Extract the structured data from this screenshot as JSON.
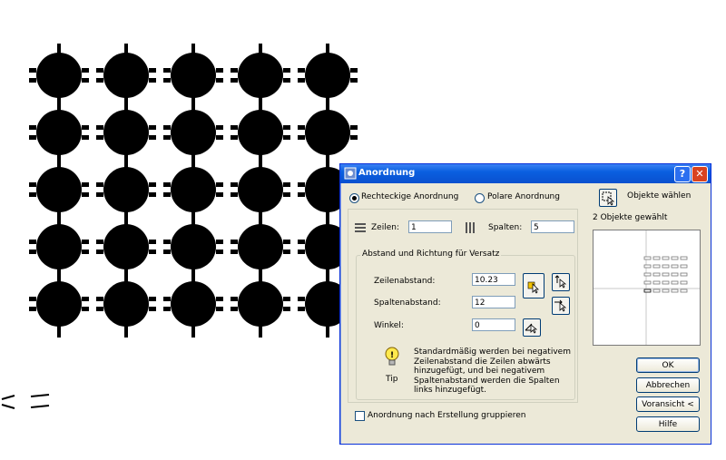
{
  "dialog": {
    "title": "Anordnung",
    "help_label": "?",
    "close_label": "✕",
    "radio_rect_label": "Rechteckige Anordnung",
    "radio_polar_label": "Polare Anordnung",
    "select_objects_label": "Objekte wählen",
    "selected_count_label": "2 Objekte gewählt",
    "rows_label": "Zeilen:",
    "rows_value": "1",
    "cols_label": "Spalten:",
    "cols_value": "5",
    "offset_group_label": "Abstand und Richtung für Versatz",
    "row_offset_label": "Zeilenabstand:",
    "row_offset_value": "10.23",
    "col_offset_label": "Spaltenabstand:",
    "col_offset_value": "12",
    "angle_label": "Winkel:",
    "angle_value": "0",
    "tip_label": "Tip",
    "tip_text": "Standardmäßig werden bei negativem Zeilenabstand die Zeilen abwärts hinzugefügt, und bei negativem Spaltenabstand werden die Spalten links hinzugefügt.",
    "group_checkbox_label": "Anordnung nach Erstellung gruppieren",
    "ok_label": "OK",
    "cancel_label": "Abbrechen",
    "preview_label": "Voransicht <",
    "help_button_label": "Hilfe"
  },
  "drawing": {
    "array_rows": 5,
    "array_cols": 5,
    "shape_color": "#000000"
  }
}
